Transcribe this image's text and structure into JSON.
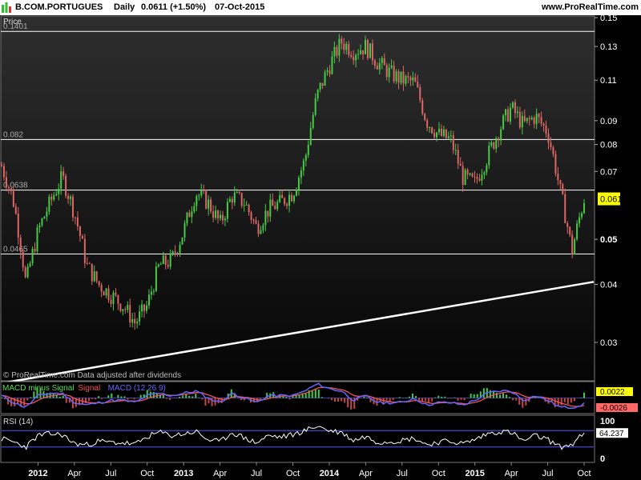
{
  "header": {
    "symbol": "B.COM.PORTUGUES",
    "period": "Daily",
    "last": "0.0611 (+1.50%)",
    "date": "07-Oct-2015",
    "site": "www.ProRealTime.com",
    "logo_colors": [
      "#33bb33",
      "#dd3333"
    ]
  },
  "colors": {
    "background": "#000000",
    "up_candle": "#44cc44",
    "down_candle": "#dd6666",
    "price_tag": "#ffff00",
    "macd_line": "#6666ff",
    "signal_line": "#ee5555",
    "rsi_line": "#ffffff",
    "rsi_bands": "#5555ff"
  },
  "chart_data": [
    {
      "type": "candlestick",
      "title": "Price",
      "watermark": "© ProRealTime.com  Data adjusted after dividends",
      "log_scale": true,
      "ylim": [
        0.025,
        0.15
      ],
      "y_ticks": [
        {
          "value": 0.15,
          "label": "0.15"
        },
        {
          "value": 0.13,
          "label": "0.13"
        },
        {
          "value": 0.11,
          "label": "0.11"
        },
        {
          "value": 0.09,
          "label": "0.09"
        },
        {
          "value": 0.08,
          "label": "0.08"
        },
        {
          "value": 0.07,
          "label": "0.07"
        },
        {
          "value": 0.05,
          "label": "0.05"
        },
        {
          "value": 0.04,
          "label": "0.04"
        },
        {
          "value": 0.03,
          "label": "0.03"
        }
      ],
      "bold_ticks": [
        "0.05"
      ],
      "last_price": "0.0611",
      "horizontal_lines": [
        {
          "value": 0.1401,
          "label": "0.1401"
        },
        {
          "value": 0.082,
          "label": "0.082"
        },
        {
          "value": 0.0638,
          "label": "0.0638"
        },
        {
          "value": 0.0465,
          "label": "0.0465"
        }
      ],
      "trendline": {
        "from": [
          "2011-10",
          0.0245
        ],
        "to": [
          "2015-10",
          0.0405
        ]
      },
      "x": [
        "2011-10",
        "2011-11",
        "2011-12",
        "2012-01",
        "2012-02",
        "2012-03",
        "2012-04",
        "2012-05",
        "2012-06",
        "2012-07",
        "2012-08",
        "2012-09",
        "2012-10",
        "2012-11",
        "2012-12",
        "2013-01",
        "2013-02",
        "2013-03",
        "2013-04",
        "2013-05",
        "2013-06",
        "2013-07",
        "2013-08",
        "2013-09",
        "2013-10",
        "2013-11",
        "2013-12",
        "2014-01",
        "2014-02",
        "2014-03",
        "2014-04",
        "2014-05",
        "2014-06",
        "2014-07",
        "2014-08",
        "2014-09",
        "2014-10",
        "2014-11",
        "2014-12",
        "2015-01",
        "2015-02",
        "2015-03",
        "2015-04",
        "2015-05",
        "2015-06",
        "2015-07",
        "2015-08",
        "2015-09",
        "2015-10"
      ],
      "close": [
        0.072,
        0.06,
        0.04,
        0.052,
        0.06,
        0.068,
        0.057,
        0.044,
        0.04,
        0.038,
        0.036,
        0.033,
        0.036,
        0.044,
        0.045,
        0.052,
        0.063,
        0.06,
        0.054,
        0.062,
        0.06,
        0.053,
        0.058,
        0.06,
        0.063,
        0.074,
        0.102,
        0.118,
        0.133,
        0.127,
        0.13,
        0.12,
        0.114,
        0.11,
        0.109,
        0.09,
        0.084,
        0.082,
        0.068,
        0.066,
        0.075,
        0.086,
        0.096,
        0.088,
        0.092,
        0.085,
        0.064,
        0.047,
        0.0611
      ],
      "x_ticks": [
        {
          "at": "2012-01",
          "label": "2012",
          "bold": true
        },
        {
          "at": "2012-04",
          "label": "Apr"
        },
        {
          "at": "2012-07",
          "label": "Jul"
        },
        {
          "at": "2012-10",
          "label": "Oct"
        },
        {
          "at": "2013-01",
          "label": "2013",
          "bold": true
        },
        {
          "at": "2013-04",
          "label": "Apr"
        },
        {
          "at": "2013-07",
          "label": "Jul"
        },
        {
          "at": "2013-10",
          "label": "Oct"
        },
        {
          "at": "2014-01",
          "label": "2014",
          "bold": true
        },
        {
          "at": "2014-04",
          "label": "Apr"
        },
        {
          "at": "2014-07",
          "label": "Jul"
        },
        {
          "at": "2014-10",
          "label": "Oct"
        },
        {
          "at": "2015-01",
          "label": "2015",
          "bold": true
        },
        {
          "at": "2015-04",
          "label": "Apr"
        },
        {
          "at": "2015-07",
          "label": "Jul"
        },
        {
          "at": "2015-10",
          "label": "Oct"
        }
      ]
    },
    {
      "type": "line",
      "title_parts": [
        {
          "text": "MACD minus Signal",
          "color": "#55dd55"
        },
        {
          "text": "Signal",
          "color": "#ee5555"
        },
        {
          "text": "MACD (12 26 9)",
          "color": "#6666ff"
        }
      ],
      "ylim": [
        -0.006,
        0.006
      ],
      "tick_labels": [
        "0.0022",
        "-0.0026"
      ],
      "macd": [
        0.001,
        -0.002,
        -0.004,
        0.001,
        0.002,
        0.002,
        -0.002,
        -0.003,
        -0.002,
        -0.001,
        -0.001,
        -0.002,
        0.001,
        0.002,
        0.001,
        0.002,
        0.003,
        0.0,
        -0.002,
        0.002,
        0.0,
        -0.002,
        0.001,
        0.001,
        0.001,
        0.003,
        0.006,
        0.004,
        0.003,
        -0.001,
        0.001,
        -0.002,
        -0.002,
        -0.002,
        0.0,
        -0.003,
        -0.002,
        -0.002,
        -0.003,
        -0.001,
        0.002,
        0.003,
        0.003,
        -0.001,
        0.001,
        -0.001,
        -0.004,
        -0.004,
        -0.0026
      ]
    },
    {
      "type": "line",
      "title": "RSI (14)",
      "ylim": [
        0,
        100
      ],
      "ticks": [
        "100",
        "0"
      ],
      "bands": [
        30,
        70
      ],
      "last_value": "64.237",
      "rsi": [
        50,
        42,
        30,
        58,
        62,
        60,
        38,
        35,
        44,
        41,
        40,
        36,
        55,
        66,
        58,
        62,
        68,
        48,
        42,
        66,
        52,
        40,
        58,
        54,
        60,
        70,
        82,
        70,
        66,
        46,
        56,
        42,
        44,
        46,
        52,
        36,
        42,
        44,
        38,
        48,
        62,
        68,
        66,
        44,
        58,
        48,
        30,
        36,
        64.237
      ]
    }
  ]
}
